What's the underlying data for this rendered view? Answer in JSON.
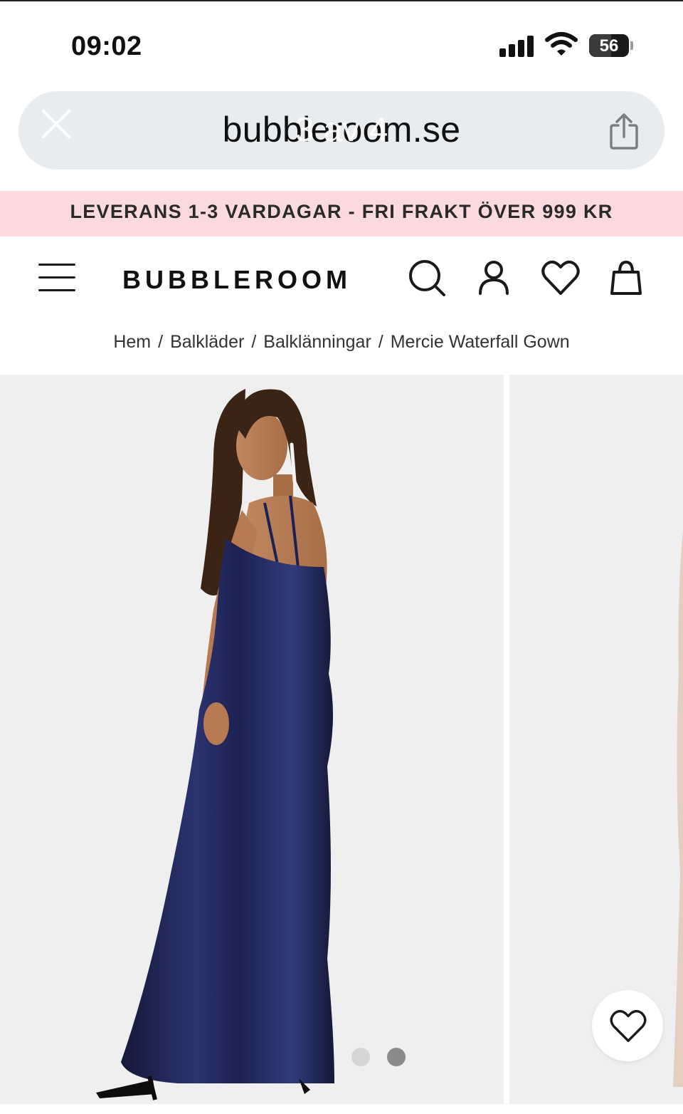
{
  "status_bar": {
    "time": "09:02",
    "battery": "56",
    "battery_level": 0.56
  },
  "browser": {
    "url": "bubbleroom.se",
    "image_counter": "3 av 4"
  },
  "promo": {
    "text": "LEVERANS 1-3 VARDAGAR - FRI FRAKT ÖVER 999 KR"
  },
  "header": {
    "logo": "BUBBLEROOM",
    "icons": [
      "menu-icon",
      "search-icon",
      "account-icon",
      "heart-icon",
      "bag-icon"
    ]
  },
  "breadcrumb": [
    "Hem",
    "Balkläder",
    "Balklänningar",
    "Mercie Waterfall Gown"
  ],
  "gallery": {
    "product": "Mercie Waterfall Gown",
    "dress_color": "#1f2452",
    "background": "#efefef",
    "dots": [
      {
        "active": false,
        "color": "#d6d6d6"
      },
      {
        "active": true,
        "color": "#8a8a8a"
      }
    ],
    "favorite_icon": "heart-icon"
  }
}
